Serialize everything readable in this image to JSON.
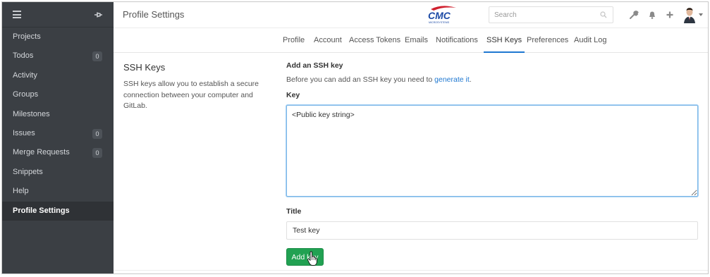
{
  "header": {
    "title": "Profile Settings",
    "logo_text": "CMC",
    "logo_subtext": "MICROSYSTEMS",
    "search_placeholder": "Search",
    "icons": [
      "wrench-icon",
      "bell-icon",
      "plus-icon"
    ]
  },
  "sidebar": {
    "items": [
      {
        "label": "Projects",
        "badge": null,
        "active": false
      },
      {
        "label": "Todos",
        "badge": "0",
        "active": false
      },
      {
        "label": "Activity",
        "badge": null,
        "active": false
      },
      {
        "label": "Groups",
        "badge": null,
        "active": false
      },
      {
        "label": "Milestones",
        "badge": null,
        "active": false
      },
      {
        "label": "Issues",
        "badge": "0",
        "active": false
      },
      {
        "label": "Merge Requests",
        "badge": "0",
        "active": false
      },
      {
        "label": "Snippets",
        "badge": null,
        "active": false
      },
      {
        "label": "Help",
        "badge": null,
        "active": false
      },
      {
        "label": "Profile Settings",
        "badge": null,
        "active": true
      }
    ]
  },
  "tabs": [
    {
      "label": "Profile",
      "active": false
    },
    {
      "label": "Account",
      "active": false
    },
    {
      "label": "Access Tokens",
      "active": false
    },
    {
      "label": "Emails",
      "active": false
    },
    {
      "label": "Notifications",
      "active": false
    },
    {
      "label": "SSH Keys",
      "active": true
    },
    {
      "label": "Preferences",
      "active": false
    },
    {
      "label": "Audit Log",
      "active": false
    }
  ],
  "section": {
    "title": "SSH Keys",
    "description": "SSH keys allow you to establish a secure connection between your computer and GitLab."
  },
  "form": {
    "title": "Add an SSH key",
    "help_prefix": "Before you can add an SSH key you need to ",
    "help_link": "generate it",
    "help_suffix": ".",
    "key_label": "Key",
    "key_value": "<Public key string>",
    "title_label": "Title",
    "title_value": "Test key",
    "submit_label": "Add key"
  },
  "colors": {
    "sidebar_bg": "#3b3f44",
    "accent": "#1f78d1",
    "button_green": "#21a152",
    "logo_red": "#d0202e",
    "logo_blue": "#1d4aa5"
  }
}
